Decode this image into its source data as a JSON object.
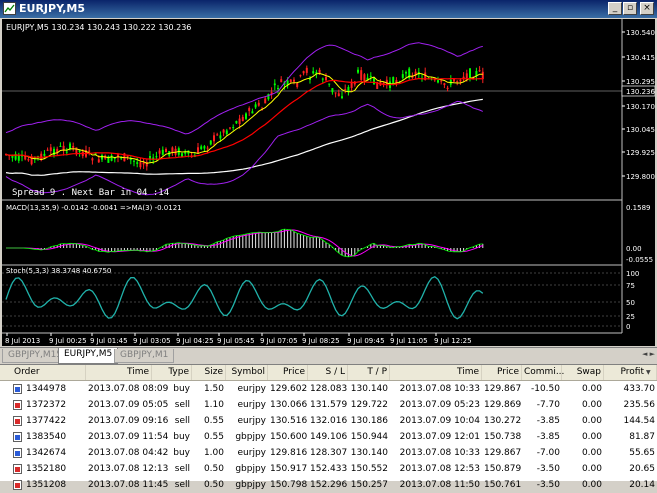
{
  "window": {
    "title": "EURJPY,M5"
  },
  "chart": {
    "info": "EURJPY,M5  130.234 130.243 130.222 130.236",
    "spread_text": "Spread  9 . Next Bar in 04 :14",
    "current_price": "130.236",
    "price_ticks": [
      "130.540",
      "130.415",
      "130.295",
      "130.170",
      "130.045",
      "129.925",
      "129.800"
    ],
    "time_ticks": [
      "8 Jul 2013",
      "9 Jul 00:25",
      "9 Jul 01:45",
      "9 Jul 03:05",
      "9 Jul 04:25",
      "9 Jul 05:45",
      "9 Jul 07:05",
      "9 Jul 08:25",
      "9 Jul 09:45",
      "9 Jul 11:05",
      "9 Jul 12:25"
    ],
    "macd_label": "MACD(13,35,9) -0.0142 -0.0041 =>MA(3) -0.0121",
    "macd_ticks": [
      "0.1589",
      "0.00",
      "-0.0555"
    ],
    "stoch_label": "Stoch(5,3,3) 38.3748 40.6750",
    "stoch_ticks": [
      "100",
      "75",
      "50",
      "25",
      "0"
    ],
    "colors": {
      "background": "#000000",
      "grid": "#808080",
      "price_line": "#ff0000",
      "ma_fast": "#ffff00",
      "ma_slow": "#ff0000",
      "ma_long": "#ffffff",
      "bollinger": "#a020f0",
      "macd_hist": "#e8e8e8",
      "macd_signal": "#ff00ff",
      "macd_line": "#00ff00",
      "stoch": "#20b2aa"
    }
  },
  "tabs": [
    {
      "label": "GBPJPY,M15",
      "active": false
    },
    {
      "label": "EURJPY,M5",
      "active": true
    },
    {
      "label": "GBPJPY,M1",
      "active": false
    }
  ],
  "terminal": {
    "columns": [
      "Order",
      "Time",
      "Type",
      "Size",
      "Symbol",
      "Price",
      "S / L",
      "T / P",
      "Time",
      "Price",
      "Commi...",
      "Swap",
      "Profit"
    ],
    "rows": [
      {
        "order": "1344978",
        "open_time": "2013.07.08 08:09",
        "type": "buy",
        "size": "1.50",
        "symbol": "eurjpy",
        "price": "129.602",
        "sl": "128.083",
        "tp": "130.140",
        "time": "2013.07.08 10:33",
        "cur_price": "129.867",
        "commission": "-10.50",
        "swap": "0.00",
        "profit": "433.70"
      },
      {
        "order": "1372372",
        "open_time": "2013.07.09 05:05",
        "type": "sell",
        "size": "1.10",
        "symbol": "eurjpy",
        "price": "130.066",
        "sl": "131.579",
        "tp": "129.722",
        "time": "2013.07.09 05:23",
        "cur_price": "129.869",
        "commission": "-7.70",
        "swap": "0.00",
        "profit": "235.56"
      },
      {
        "order": "1377422",
        "open_time": "2013.07.09 09:16",
        "type": "sell",
        "size": "0.55",
        "symbol": "eurjpy",
        "price": "130.516",
        "sl": "132.016",
        "tp": "130.186",
        "time": "2013.07.09 10:04",
        "cur_price": "130.272",
        "commission": "-3.85",
        "swap": "0.00",
        "profit": "144.54"
      },
      {
        "order": "1383540",
        "open_time": "2013.07.09 11:54",
        "type": "buy",
        "size": "0.55",
        "symbol": "gbpjpy",
        "price": "150.600",
        "sl": "149.106",
        "tp": "150.944",
        "time": "2013.07.09 12:01",
        "cur_price": "150.738",
        "commission": "-3.85",
        "swap": "0.00",
        "profit": "81.87"
      },
      {
        "order": "1342674",
        "open_time": "2013.07.08 04:42",
        "type": "buy",
        "size": "1.00",
        "symbol": "eurjpy",
        "price": "129.816",
        "sl": "128.307",
        "tp": "130.140",
        "time": "2013.07.08 10:33",
        "cur_price": "129.867",
        "commission": "-7.00",
        "swap": "0.00",
        "profit": "55.65"
      },
      {
        "order": "1352180",
        "open_time": "2013.07.08 12:13",
        "type": "sell",
        "size": "0.50",
        "symbol": "gbpjpy",
        "price": "150.917",
        "sl": "152.433",
        "tp": "150.552",
        "time": "2013.07.08 12:53",
        "cur_price": "150.879",
        "commission": "-3.50",
        "swap": "0.00",
        "profit": "20.65"
      },
      {
        "order": "1351208",
        "open_time": "2013.07.08 11:45",
        "type": "sell",
        "size": "0.50",
        "symbol": "gbpjpy",
        "price": "150.798",
        "sl": "152.296",
        "tp": "150.257",
        "time": "2013.07.08 11:50",
        "cur_price": "150.761",
        "commission": "-3.50",
        "swap": "0.00",
        "profit": "20.14"
      }
    ]
  }
}
